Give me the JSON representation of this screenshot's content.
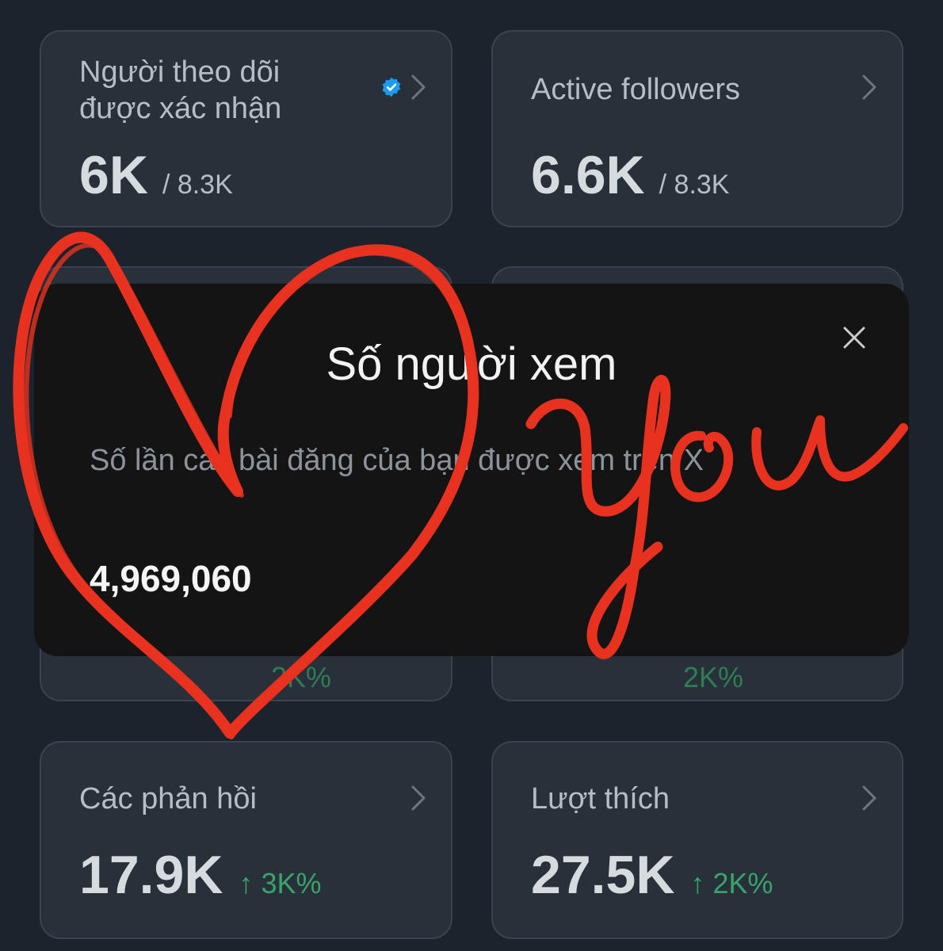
{
  "cards": [
    {
      "title": "Người theo dõi\nđược xác nhận",
      "value": "6K",
      "sub": "/ 8.3K"
    },
    {
      "title": "Active followers",
      "value": "6.6K",
      "sub": "/ 8.3K"
    },
    {
      "value": "",
      "delta": "2K%"
    },
    {
      "value": "",
      "delta": "2K%"
    },
    {
      "title": "Các phản hồi",
      "value": "17.9K",
      "delta": "3K%"
    },
    {
      "title": "Lượt thích",
      "value": "27.5K",
      "delta": "2K%"
    }
  ],
  "modal": {
    "title": "Số người xem",
    "description": "Số lần các bài đăng của bạn được xem trên X",
    "value": "4,969,060"
  },
  "colors": {
    "background": "#1d232c",
    "card": "#28303a",
    "modal": "#141414",
    "positive": "#3aa36b",
    "verified": "#1d9bf0",
    "scribble": "#e8321f"
  },
  "icons": {
    "verified": "verified-badge-icon",
    "chevron": "chevron-right-icon",
    "close": "close-icon"
  },
  "annotation": {
    "text": "you"
  }
}
